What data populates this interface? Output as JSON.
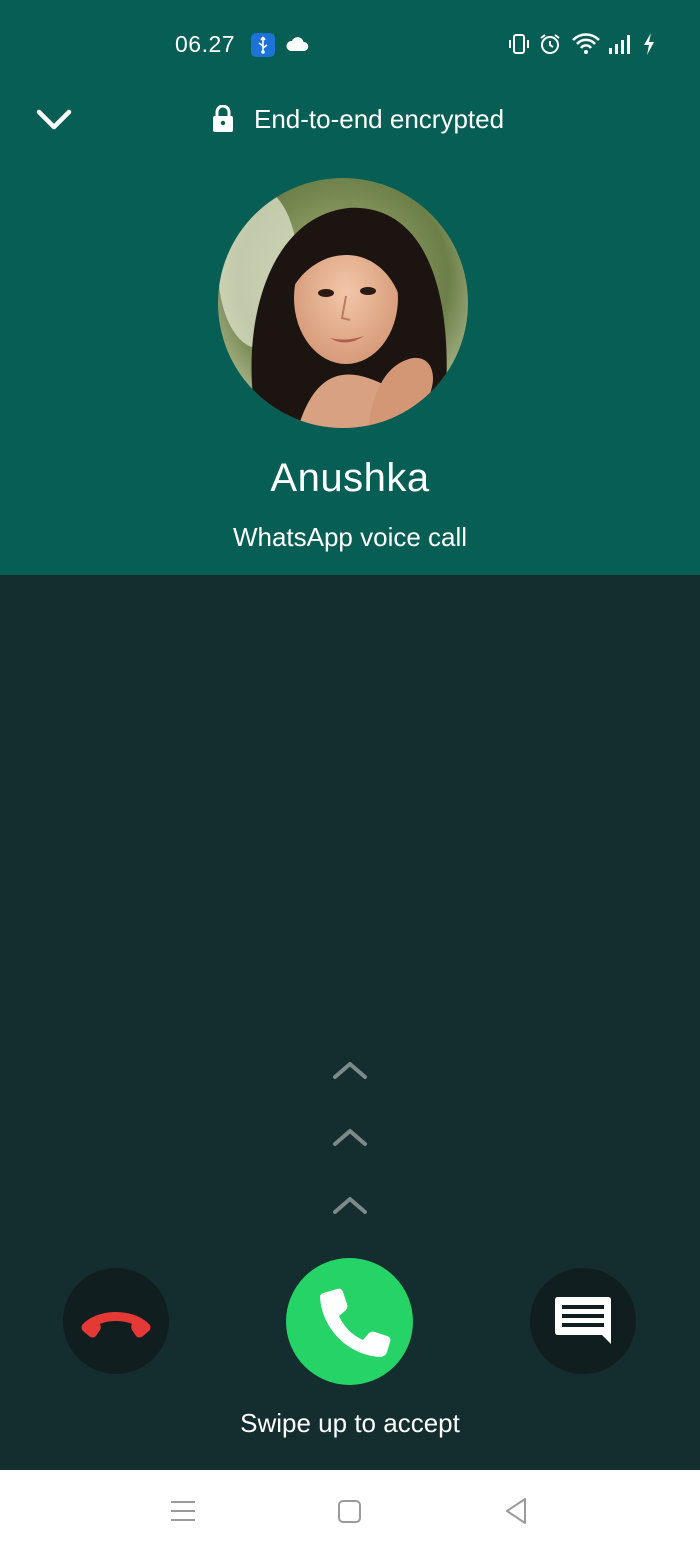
{
  "status_bar": {
    "time": "06.27",
    "left_icons": [
      "usb-icon",
      "cloud-icon"
    ],
    "right_icons": [
      "vibrate-icon",
      "alarm-icon",
      "wifi-icon",
      "signal-icon",
      "charging-icon"
    ]
  },
  "header": {
    "collapse_icon": "chevron-down-icon",
    "encryption_text": "End-to-end encrypted"
  },
  "caller": {
    "name": "Anushka",
    "call_type": "WhatsApp voice call"
  },
  "actions": {
    "decline_icon": "phone-hangup-icon",
    "accept_icon": "phone-icon",
    "message_icon": "message-icon",
    "swipe_hint": "Swipe up to accept"
  },
  "colors": {
    "header_bg": "#075e54",
    "body_bg": "#142d2f",
    "accept": "#25d366",
    "decline": "#e53935"
  },
  "nav": [
    "menu-icon",
    "home-icon",
    "back-icon"
  ]
}
